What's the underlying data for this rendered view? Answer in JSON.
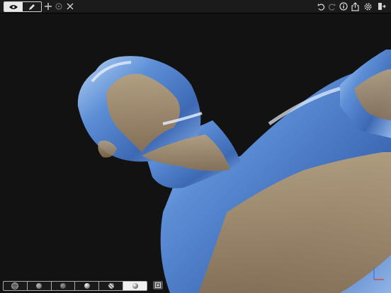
{
  "toolbar": {
    "left_modes": [
      {
        "name": "view-mode",
        "icon": "eye-icon",
        "active": true
      },
      {
        "name": "draw-mode",
        "icon": "pencil-icon",
        "active": false
      }
    ],
    "left_tools": [
      "move-icon",
      "target-icon",
      "cut-icon"
    ],
    "right_tools": [
      "undo-icon",
      "redo-icon",
      "info-icon",
      "share-icon",
      "settings-icon",
      "exit-icon"
    ]
  },
  "bottom_bar": {
    "materials": [
      {
        "name": "material-wireframe",
        "active": false
      },
      {
        "name": "material-matte",
        "active": false
      },
      {
        "name": "material-flat",
        "active": false
      },
      {
        "name": "material-shiny",
        "active": false
      },
      {
        "name": "material-striped",
        "active": false
      },
      {
        "name": "material-reflective",
        "active": true
      }
    ],
    "export": "export-icon"
  },
  "colors": {
    "background": "#121212",
    "model_blue": "#4f7fcf",
    "reflection_tan": "#a08660",
    "axis_x": "#d24a3a",
    "axis_y": "#3f7de0"
  }
}
